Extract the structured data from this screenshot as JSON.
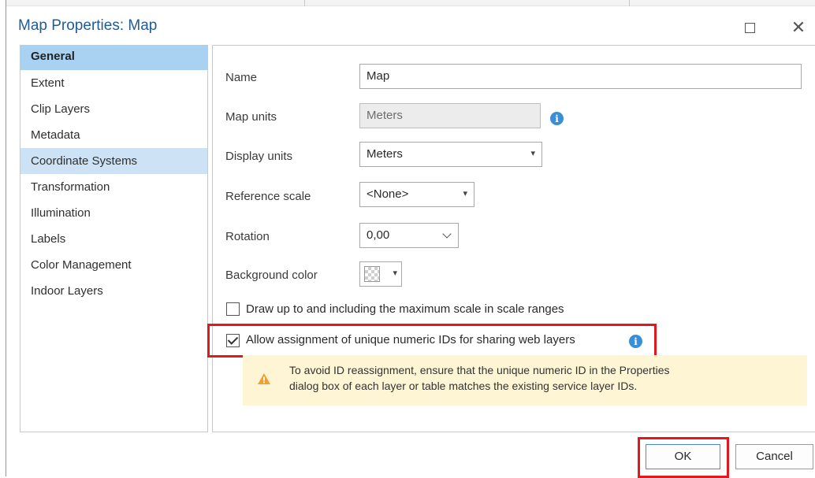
{
  "window": {
    "title": "Map Properties: Map",
    "maximize_icon": "maximize-icon",
    "close_icon": "close-icon",
    "close_glyph": "✕"
  },
  "nav": {
    "items": [
      {
        "label": "General",
        "state": "selected"
      },
      {
        "label": "Extent"
      },
      {
        "label": "Clip Layers"
      },
      {
        "label": "Metadata"
      },
      {
        "label": "Coordinate Systems",
        "state": "hover"
      },
      {
        "label": "Transformation"
      },
      {
        "label": "Illumination"
      },
      {
        "label": "Labels"
      },
      {
        "label": "Color Management"
      },
      {
        "label": "Indoor Layers"
      }
    ]
  },
  "general": {
    "name_label": "Name",
    "name_value": "Map",
    "map_units_label": "Map units",
    "map_units_value": "Meters",
    "display_units_label": "Display units",
    "display_units_value": "Meters",
    "reference_scale_label": "Reference scale",
    "reference_scale_value": "<None>",
    "rotation_label": "Rotation",
    "rotation_value": "0,00",
    "background_color_label": "Background color",
    "draw_max_scale_label": "Draw up to and including the maximum scale in scale ranges",
    "draw_max_scale_checked": false,
    "unique_ids_label": "Allow assignment of unique numeric IDs for sharing web layers",
    "unique_ids_checked": true,
    "warning_line1": "To avoid ID reassignment, ensure that the unique numeric ID in the Properties",
    "warning_line2": "dialog box of each layer or table matches the existing service layer IDs."
  },
  "footer": {
    "ok_label": "OK",
    "cancel_label": "Cancel"
  },
  "colors": {
    "title": "#1f5c98",
    "selected_nav": "#a9d1f1",
    "hover_nav": "#cde3f5",
    "info_blue": "#3a8ed6",
    "warning_bg": "#fdf5d3",
    "warning_icon": "#f0a030",
    "highlight_red": "#e0191e"
  }
}
